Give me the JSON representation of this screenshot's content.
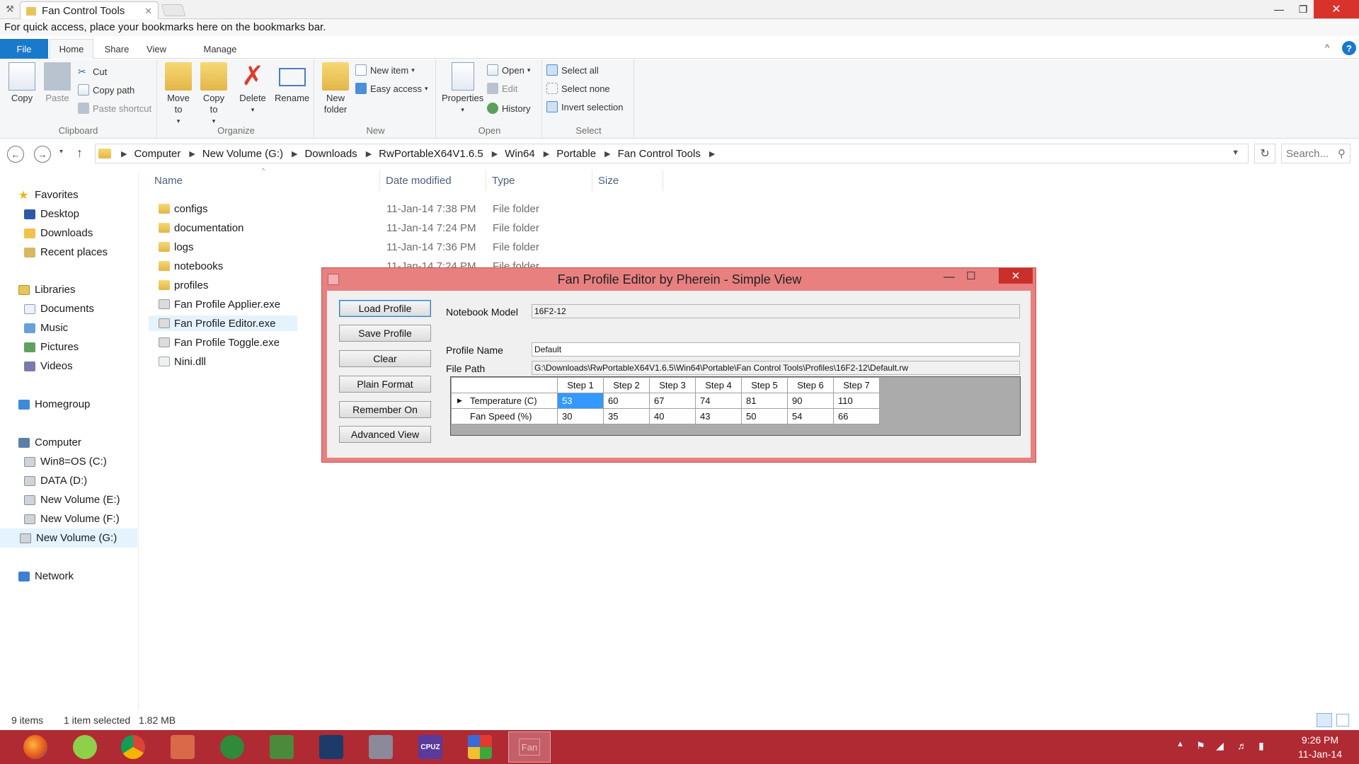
{
  "browser": {
    "tab_title": "Fan Control Tools",
    "bookmarks_bar_text": "For quick access, place your bookmarks here on the bookmarks bar."
  },
  "ribbon": {
    "tabs": [
      "File",
      "Home",
      "Share",
      "View",
      "Manage"
    ],
    "clipboard": {
      "label": "Clipboard",
      "copy": "Copy",
      "paste": "Paste",
      "cut": "Cut",
      "copy_path": "Copy path",
      "paste_shortcut": "Paste shortcut"
    },
    "organize": {
      "label": "Organize",
      "move_to": "Move to",
      "copy_to": "Copy to",
      "delete": "Delete",
      "rename": "Rename"
    },
    "new": {
      "label": "New",
      "new_folder": "New folder",
      "new_item": "New item",
      "easy_access": "Easy access"
    },
    "open": {
      "label": "Open",
      "properties": "Properties",
      "open": "Open",
      "edit": "Edit",
      "history": "History"
    },
    "select": {
      "label": "Select",
      "select_all": "Select all",
      "select_none": "Select none",
      "invert_selection": "Invert selection"
    }
  },
  "address": {
    "crumbs": [
      "Computer",
      "New Volume (G:)",
      "Downloads",
      "RwPortableX64V1.6.5",
      "Win64",
      "Portable",
      "Fan Control Tools"
    ],
    "search_placeholder": "Search..."
  },
  "navpane": {
    "favorites": "Favorites",
    "desktop": "Desktop",
    "downloads": "Downloads",
    "recent_places": "Recent places",
    "libraries": "Libraries",
    "documents": "Documents",
    "music": "Music",
    "pictures": "Pictures",
    "videos": "Videos",
    "homegroup": "Homegroup",
    "computer": "Computer",
    "drive_c": "Win8=OS (C:)",
    "drive_d": "DATA (D:)",
    "drive_e": "New Volume (E:)",
    "drive_f": "New Volume (F:)",
    "drive_g": "New Volume (G:)",
    "network": "Network"
  },
  "filelist": {
    "columns": {
      "name": "Name",
      "date": "Date modified",
      "type": "Type",
      "size": "Size"
    },
    "rows": [
      {
        "name": "configs",
        "date": "11-Jan-14 7:38 PM",
        "type": "File folder"
      },
      {
        "name": "documentation",
        "date": "11-Jan-14 7:24 PM",
        "type": "File folder"
      },
      {
        "name": "logs",
        "date": "11-Jan-14 7:36 PM",
        "type": "File folder"
      },
      {
        "name": "notebooks",
        "date": "11-Jan-14 7:24 PM",
        "type": "File folder"
      },
      {
        "name": "profiles",
        "date": "",
        "type": ""
      },
      {
        "name": "Fan Profile Applier.exe",
        "date": "",
        "type": ""
      },
      {
        "name": "Fan Profile Editor.exe",
        "date": "",
        "type": ""
      },
      {
        "name": "Fan Profile Toggle.exe",
        "date": "",
        "type": ""
      },
      {
        "name": "Nini.dll",
        "date": "",
        "type": ""
      }
    ]
  },
  "status": {
    "count": "9 items",
    "selected": "1 item selected",
    "size": "1.82 MB"
  },
  "dialog": {
    "title": "Fan Profile Editor by Pherein - Simple View",
    "buttons": {
      "load_profile": "Load Profile",
      "save_profile": "Save Profile",
      "clear": "Clear",
      "plain_format": "Plain Format",
      "remember_on": "Remember On",
      "advanced_view": "Advanced View"
    },
    "notebook_model_label": "Notebook Model",
    "notebook_model": "16F2-12",
    "profile_name_label": "Profile Name",
    "profile_name": "Default",
    "file_path_label": "File Path",
    "file_path": "G:\\Downloads\\RwPortableX64V1.6.5\\Win64\\Portable\\Fan Control Tools\\Profiles\\16F2-12\\Default.rw",
    "grid": {
      "columns": [
        "Step 1",
        "Step 2",
        "Step 3",
        "Step 4",
        "Step 5",
        "Step 6",
        "Step 7"
      ],
      "rows": [
        {
          "label": "Temperature (C)",
          "values": [
            "53",
            "60",
            "67",
            "74",
            "81",
            "90",
            "110"
          ]
        },
        {
          "label": "Fan Speed (%)",
          "values": [
            "30",
            "35",
            "40",
            "43",
            "50",
            "54",
            "66"
          ]
        }
      ]
    }
  },
  "taskbar": {
    "active_item_label": "Fan",
    "cpuz_label": "CPUZ",
    "clock_time": "9:26 PM",
    "clock_date": "11-Jan-14"
  },
  "colors": {
    "dialog_frame": "#e88080",
    "taskbar": "#b02a34",
    "file_tab": "#1979ca",
    "selection": "#e5f3ff",
    "grid_selected_cell": "#3399ff"
  }
}
